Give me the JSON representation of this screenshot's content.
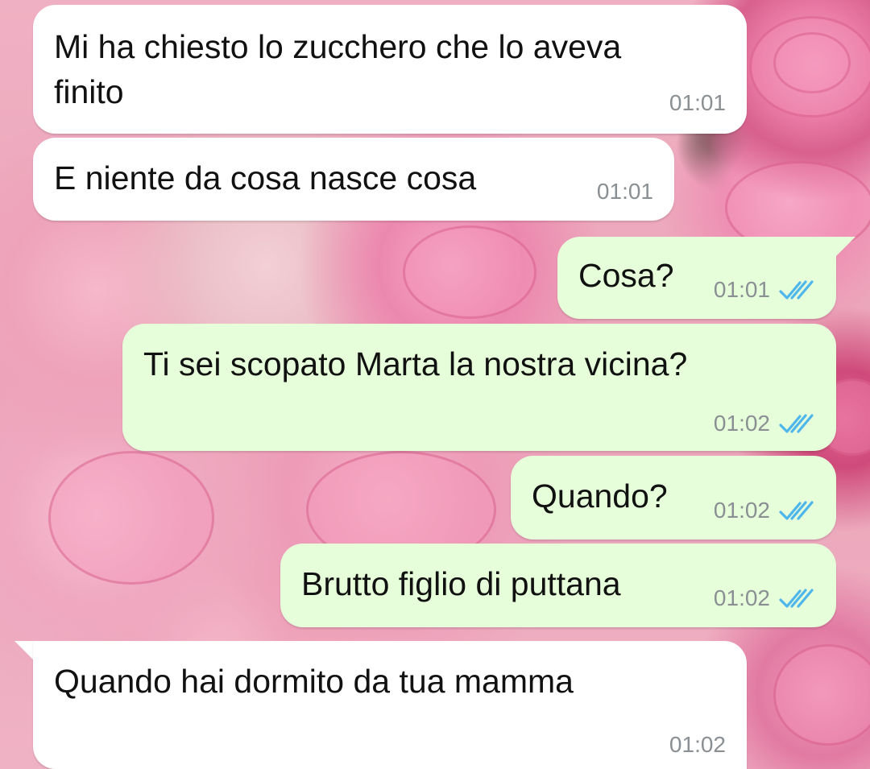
{
  "messages": [
    {
      "direction": "incoming",
      "text": "Mi ha chiesto lo zucchero che lo aveva finito",
      "line1": "Mi ha chiesto lo zucchero che lo aveva",
      "line2": "finito",
      "time": "01:01"
    },
    {
      "direction": "incoming",
      "text": "E niente da cosa nasce cosa",
      "time": "01:01"
    },
    {
      "direction": "outgoing",
      "text": "Cosa?",
      "time": "01:01",
      "status": "read"
    },
    {
      "direction": "outgoing",
      "text": "Ti sei scopato Marta la nostra vicina?",
      "time": "01:02",
      "status": "read"
    },
    {
      "direction": "outgoing",
      "text": "Quando?",
      "time": "01:02",
      "status": "read"
    },
    {
      "direction": "outgoing",
      "text": "Brutto figlio di puttana",
      "time": "01:02",
      "status": "read"
    },
    {
      "direction": "incoming",
      "text": "Quando hai dormito da tua mamma",
      "time": "01:02"
    }
  ],
  "colors": {
    "incoming_bubble": "#ffffff",
    "outgoing_bubble": "#e6ffda",
    "read_ticks": "#4fb6ec",
    "timestamp": "#8a8f93"
  },
  "icons": {
    "read_receipt": "double-check-icon"
  }
}
